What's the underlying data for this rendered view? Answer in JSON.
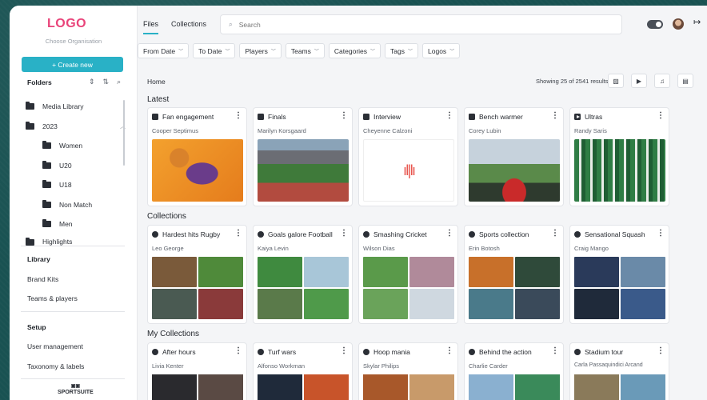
{
  "app": {
    "logo": "LOGO",
    "org_label": "Choose Organisation",
    "create_label": "+ Create new",
    "brand": "SPORTSUITE"
  },
  "folders": {
    "title": "Folders",
    "items": [
      {
        "label": "Media Library",
        "level": 0
      },
      {
        "label": "2023",
        "level": 0,
        "expanded": true
      },
      {
        "label": "Women",
        "level": 1
      },
      {
        "label": "U20",
        "level": 1
      },
      {
        "label": "U18",
        "level": 1
      },
      {
        "label": "Non Match",
        "level": 1
      },
      {
        "label": "Men",
        "level": 1
      },
      {
        "label": "Highlights",
        "level": 0
      }
    ]
  },
  "sidebar": {
    "library_title": "Library",
    "library_items": [
      "Brand Kits",
      "Teams & players"
    ],
    "setup_title": "Setup",
    "setup_items": [
      "User management",
      "Taxonomy & labels"
    ]
  },
  "topnav": {
    "tabs": [
      {
        "label": "Files",
        "active": true
      },
      {
        "label": "Collections",
        "active": false
      }
    ],
    "search_placeholder": "Search"
  },
  "filters": [
    "From Date",
    "To Date",
    "Players",
    "Teams",
    "Categories",
    "Tags",
    "Logos"
  ],
  "content": {
    "breadcrumb": "Home",
    "showing": "Showing 25 of 2541 results"
  },
  "latest": {
    "title": "Latest",
    "cards": [
      {
        "title": "Fan engagement",
        "author": "Cooper Septimus",
        "type": "image"
      },
      {
        "title": "Finals",
        "author": "Marilyn Korsgaard",
        "type": "image"
      },
      {
        "title": "Interview",
        "author": "Cheyenne Calzoni",
        "type": "audio"
      },
      {
        "title": "Bench warmer",
        "author": "Corey Lubin",
        "type": "image"
      },
      {
        "title": "Ultras",
        "author": "Randy Saris",
        "type": "video"
      }
    ]
  },
  "collections": {
    "title": "Collections",
    "cards": [
      {
        "title": "Hardest hits Rugby",
        "author": "Leo George"
      },
      {
        "title": "Goals galore Football",
        "author": "Kaiya Levin"
      },
      {
        "title": "Smashing Cricket",
        "author": "Wilson Dias"
      },
      {
        "title": "Sports collection",
        "author": "Erin Botosh"
      },
      {
        "title": "Sensational Squash",
        "author": "Craig Mango"
      }
    ]
  },
  "my_collections": {
    "title": "My Collections",
    "cards": [
      {
        "title": "After hours",
        "author": "Livia Kenter"
      },
      {
        "title": "Turf wars",
        "author": "Alfonso Workman"
      },
      {
        "title": "Hoop mania",
        "author": "Skylar Philips"
      },
      {
        "title": "Behind the action",
        "author": "Charlie Carder"
      },
      {
        "title": "Stadium tour",
        "author": "Carla Passaquindici Arcand"
      }
    ]
  },
  "colors": {
    "accent": "#29b1c6",
    "logo": "#e9447a"
  }
}
